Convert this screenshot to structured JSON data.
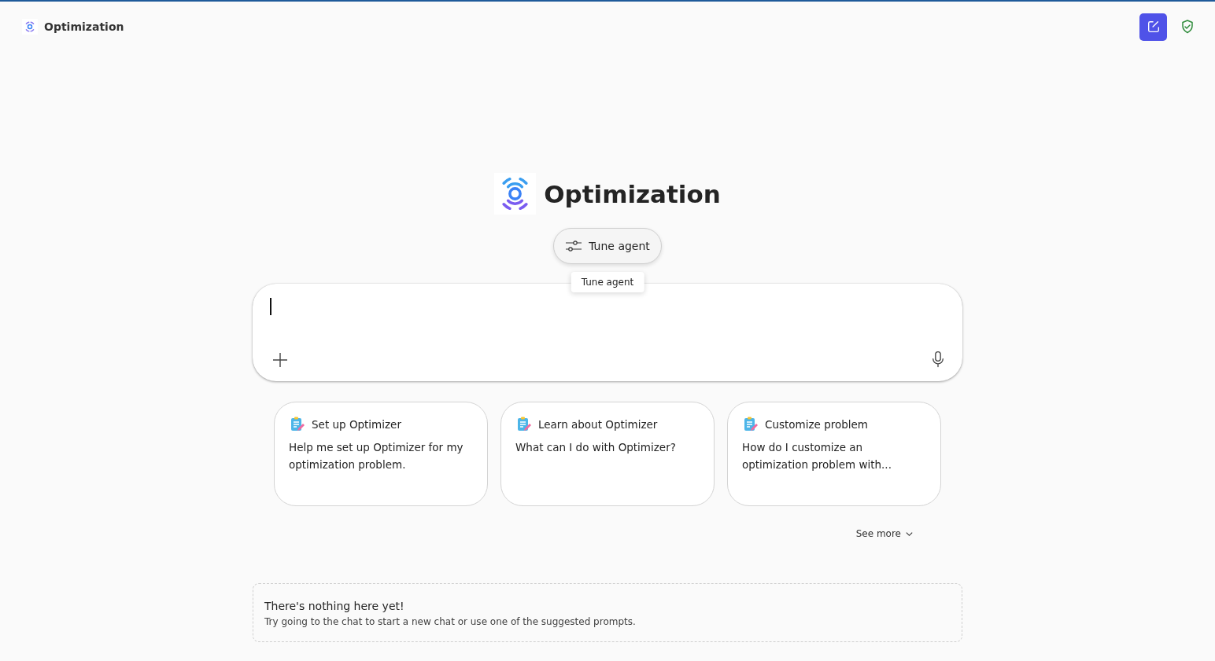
{
  "header": {
    "title": "Optimization"
  },
  "hero": {
    "title": "Optimization",
    "tune_button": "Tune agent",
    "tooltip": "Tune agent"
  },
  "prompts": [
    {
      "title": "Set up Optimizer",
      "text": "Help me set up Optimizer for my optimization problem."
    },
    {
      "title": "Learn about Optimizer",
      "text": "What can I do with Optimizer?"
    },
    {
      "title": "Customize problem",
      "text": "How do I customize an optimization problem with..."
    }
  ],
  "see_more": "See more",
  "empty_state": {
    "title": "There's nothing here yet!",
    "text": "Try going to the chat to start a new chat or use one of the suggested prompts."
  }
}
